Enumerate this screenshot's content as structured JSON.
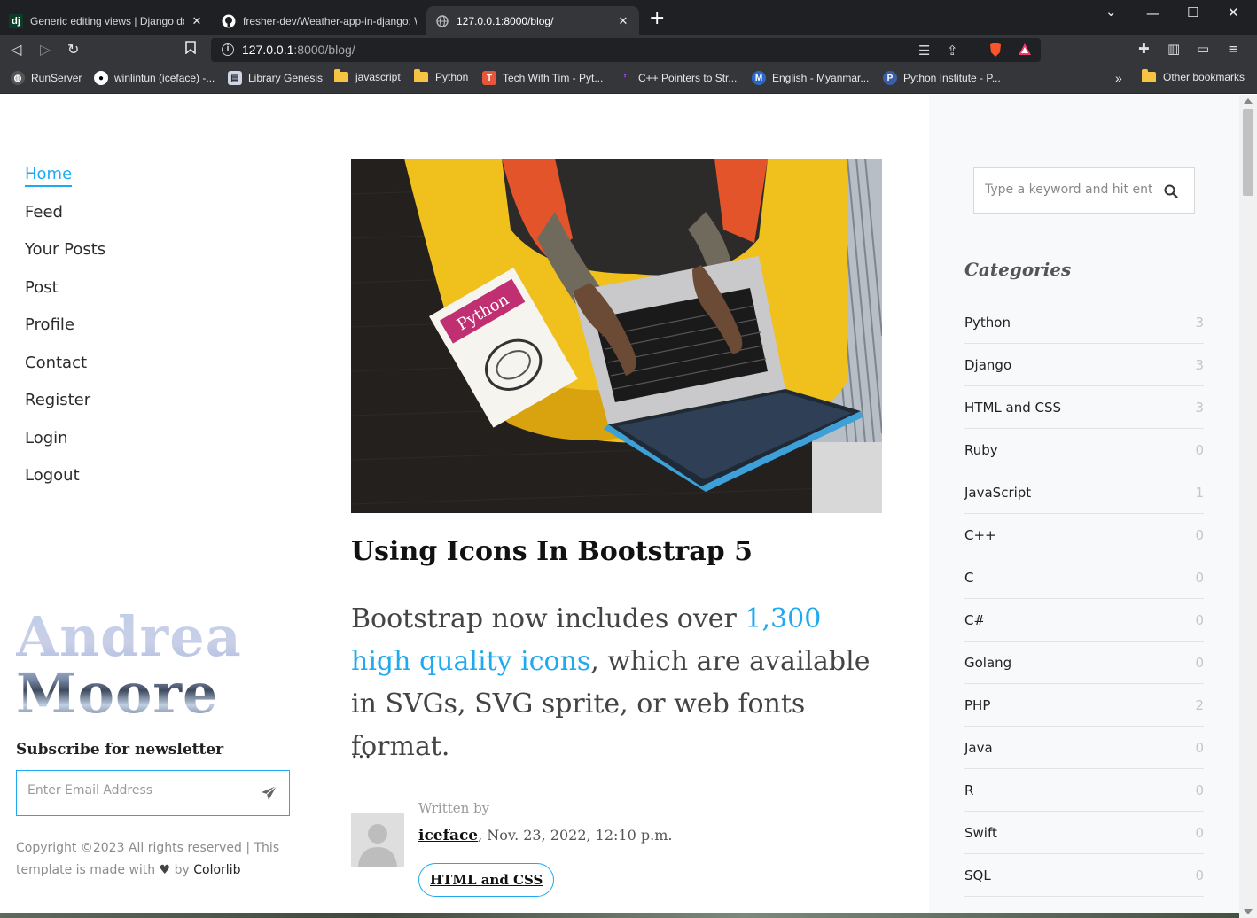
{
  "browser": {
    "tabs": [
      {
        "favicon": "dj",
        "title": "Generic editing views | Django doc",
        "active": false
      },
      {
        "favicon": "github-icon",
        "title": "fresher-dev/Weather-app-in-django: W",
        "active": false
      },
      {
        "favicon": "globe-icon",
        "title": "127.0.0.1:8000/blog/",
        "active": true
      }
    ],
    "url_host": "127.0.0.1",
    "url_path": ":8000/blog/",
    "bookmarks": [
      {
        "icon": "globe-icon",
        "label": "RunServer"
      },
      {
        "icon": "github-icon",
        "label": "winlintun (iceface) -..."
      },
      {
        "icon": "book-icon",
        "label": "Library Genesis"
      },
      {
        "icon": "folder-icon",
        "label": "javascript"
      },
      {
        "icon": "folder-icon",
        "label": "Python"
      },
      {
        "icon": "twt-icon",
        "label": "Tech With Tim - Pyt..."
      },
      {
        "icon": "pointer-icon",
        "label": "C++ Pointers to Str..."
      },
      {
        "icon": "dictionary-icon",
        "label": "English - Myanmar..."
      },
      {
        "icon": "python-institute-icon",
        "label": "Python Institute - P..."
      }
    ],
    "other_bookmarks": "Other bookmarks",
    "overflow": "»"
  },
  "sidebar": {
    "nav": [
      "Home",
      "Feed",
      "Your Posts",
      "Post",
      "Profile",
      "Contact",
      "Register",
      "Login",
      "Logout"
    ],
    "active_index": 0,
    "logo_line1": "Andrea",
    "logo_line2": "Moore",
    "newsletter_heading": "Subscribe for newsletter",
    "email_placeholder": "Enter Email Address",
    "copyright_text": "Copyright ©2023 All rights reserved | This template is made with",
    "copyright_by": "by",
    "copyright_link": "Colorlib"
  },
  "post": {
    "title": "Using Icons In Bootstrap 5",
    "excerpt_before": "Bootstrap now includes over ",
    "excerpt_link": "1,300 high quality icons",
    "excerpt_after": ", which are available in SVGs, SVG sprite, or web fonts format.",
    "ellipsis": "...",
    "written_by": "Written by",
    "author": "iceface",
    "date": ", Nov. 23, 2022, 12:10 p.m.",
    "tag": "HTML and CSS"
  },
  "right": {
    "search_placeholder": "Type a keyword and hit enter",
    "categories_heading": "Categories",
    "categories": [
      {
        "name": "Python",
        "count": "3"
      },
      {
        "name": "Django",
        "count": "3"
      },
      {
        "name": "HTML and CSS",
        "count": "3"
      },
      {
        "name": "Ruby",
        "count": "0"
      },
      {
        "name": "JavaScript",
        "count": "1"
      },
      {
        "name": "C++",
        "count": "0"
      },
      {
        "name": "C",
        "count": "0"
      },
      {
        "name": "C#",
        "count": "0"
      },
      {
        "name": "Golang",
        "count": "0"
      },
      {
        "name": "PHP",
        "count": "2"
      },
      {
        "name": "Java",
        "count": "0"
      },
      {
        "name": "R",
        "count": "0"
      },
      {
        "name": "Swift",
        "count": "0"
      },
      {
        "name": "SQL",
        "count": "0"
      }
    ]
  },
  "colors": {
    "accent": "#1eaaf1",
    "chrome_dark": "#1f2023",
    "chrome_mid": "#35363a"
  }
}
